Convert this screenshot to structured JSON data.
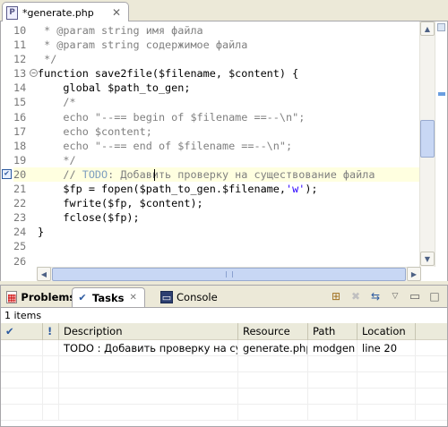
{
  "editor": {
    "tab_label": "*generate.php",
    "lines": [
      {
        "n": "10",
        "parts": [
          {
            "t": " * @param string имя файла",
            "c": "c-doc"
          }
        ]
      },
      {
        "n": "11",
        "parts": [
          {
            "t": " * @param string содержимое файла",
            "c": "c-doc"
          }
        ]
      },
      {
        "n": "12",
        "parts": [
          {
            "t": " */",
            "c": "c-doc"
          }
        ]
      },
      {
        "n": "13",
        "parts": [
          {
            "t": "function save2file($filename, $content) {",
            "c": "c-kw"
          }
        ],
        "fold": "−"
      },
      {
        "n": "14",
        "parts": [
          {
            "t": "    global $path_to_gen;",
            "c": "c-kw"
          }
        ]
      },
      {
        "n": "15",
        "parts": [
          {
            "t": "    /*",
            "c": "c-doc"
          }
        ]
      },
      {
        "n": "16",
        "parts": [
          {
            "t": "    echo \"--== begin of $filename ==--\\n\";",
            "c": "c-doc"
          }
        ]
      },
      {
        "n": "17",
        "parts": [
          {
            "t": "    echo $content;",
            "c": "c-doc"
          }
        ]
      },
      {
        "n": "18",
        "parts": [
          {
            "t": "    echo \"--== end of $filename ==--\\n\";",
            "c": "c-doc"
          }
        ]
      },
      {
        "n": "19",
        "parts": [
          {
            "t": "    */",
            "c": "c-doc"
          }
        ]
      },
      {
        "n": "20",
        "parts": [
          {
            "t": "    // ",
            "c": "c-doc"
          },
          {
            "t": "TODO",
            "c": "c-todo"
          },
          {
            "t": ": Добавить проверку на существование файла",
            "c": "c-doc"
          }
        ],
        "highlight": true,
        "task": true
      },
      {
        "n": "21",
        "parts": [
          {
            "t": "    $fp = fopen($path_to_gen.$filename,",
            "c": "c-kw"
          },
          {
            "t": "'w'",
            "c": "c-str"
          },
          {
            "t": ");",
            "c": "c-kw"
          }
        ]
      },
      {
        "n": "22",
        "parts": [
          {
            "t": "    fwrite($fp, $content);",
            "c": "c-kw"
          }
        ]
      },
      {
        "n": "23",
        "parts": [
          {
            "t": "    fclose($fp);",
            "c": "c-kw"
          }
        ]
      },
      {
        "n": "24",
        "parts": [
          {
            "t": "}",
            "c": "c-kw"
          }
        ]
      },
      {
        "n": "25",
        "parts": [
          {
            "t": "",
            "c": "c-kw"
          }
        ]
      },
      {
        "n": "26",
        "parts": [
          {
            "t": "",
            "c": "c-kw"
          }
        ]
      }
    ]
  },
  "view": {
    "tabs": [
      {
        "label": "Problems",
        "icon": "problems-icon"
      },
      {
        "label": "Tasks",
        "icon": "tasks-icon"
      },
      {
        "label": "Console",
        "icon": "console-icon"
      }
    ],
    "item_count": "1 items",
    "columns": [
      "",
      "!",
      "Description",
      "Resource",
      "Path",
      "Location"
    ],
    "rows": [
      {
        "check": "",
        "prio": "",
        "description": "TODO : Добавить проверку на сущ...",
        "resource": "generate.php",
        "path": "modgen",
        "location": "line 20"
      }
    ]
  }
}
